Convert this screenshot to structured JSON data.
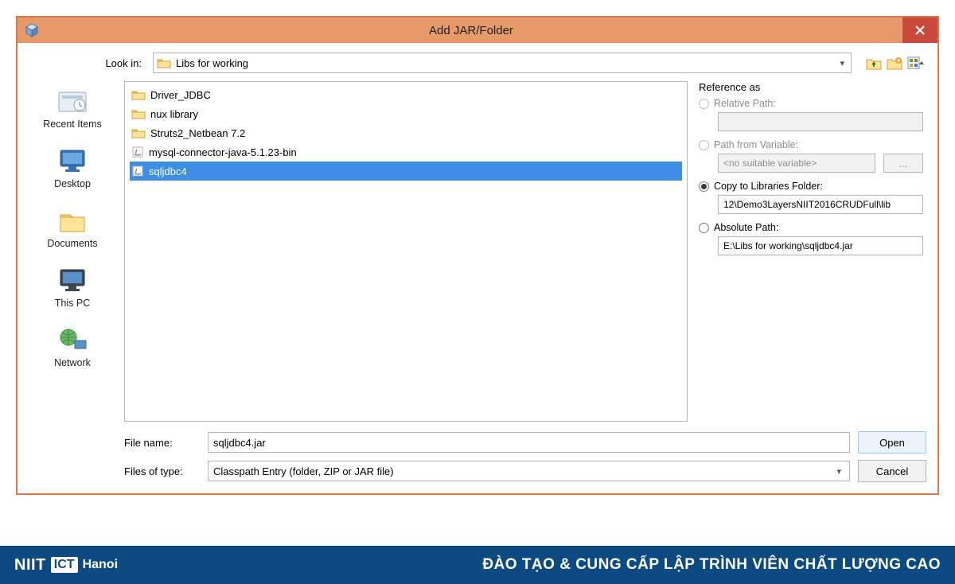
{
  "dialog": {
    "title": "Add JAR/Folder",
    "lookin_label": "Look in:",
    "lookin_value": "Libs for working",
    "places": [
      {
        "label": "Recent Items"
      },
      {
        "label": "Desktop"
      },
      {
        "label": "Documents"
      },
      {
        "label": "This PC"
      },
      {
        "label": "Network"
      }
    ],
    "files": [
      {
        "name": "Driver_JDBC",
        "type": "folder"
      },
      {
        "name": "nux library",
        "type": "folder"
      },
      {
        "name": "Struts2_Netbean 7.2",
        "type": "folder"
      },
      {
        "name": "mysql-connector-java-5.1.23-bin",
        "type": "jar"
      },
      {
        "name": "sqljdbc4",
        "type": "jar",
        "selected": true
      }
    ],
    "reference": {
      "title": "Reference as",
      "relative_label": "Relative Path:",
      "relative_value": "",
      "variable_label": "Path from Variable:",
      "variable_value": "<no suitable variable>",
      "variable_btn": "...",
      "copy_label": "Copy to Libraries Folder:",
      "copy_value": "12\\Demo3LayersNIIT2016CRUDFull\\lib",
      "absolute_label": "Absolute Path:",
      "absolute_value": "E:\\Libs for working\\sqljdbc4.jar"
    },
    "filename_label": "File name:",
    "filename_value": "sqljdbc4.jar",
    "filetype_label": "Files of type:",
    "filetype_value": "Classpath Entry (folder, ZIP or JAR file)",
    "open_btn": "Open",
    "cancel_btn": "Cancel"
  },
  "footer": {
    "logo_niit": "NIIT",
    "logo_ict": "ICT",
    "logo_hanoi": "Hanoi",
    "tagline": "ĐÀO TẠO & CUNG CẤP LẬP TRÌNH VIÊN CHẤT LƯỢNG CAO"
  }
}
